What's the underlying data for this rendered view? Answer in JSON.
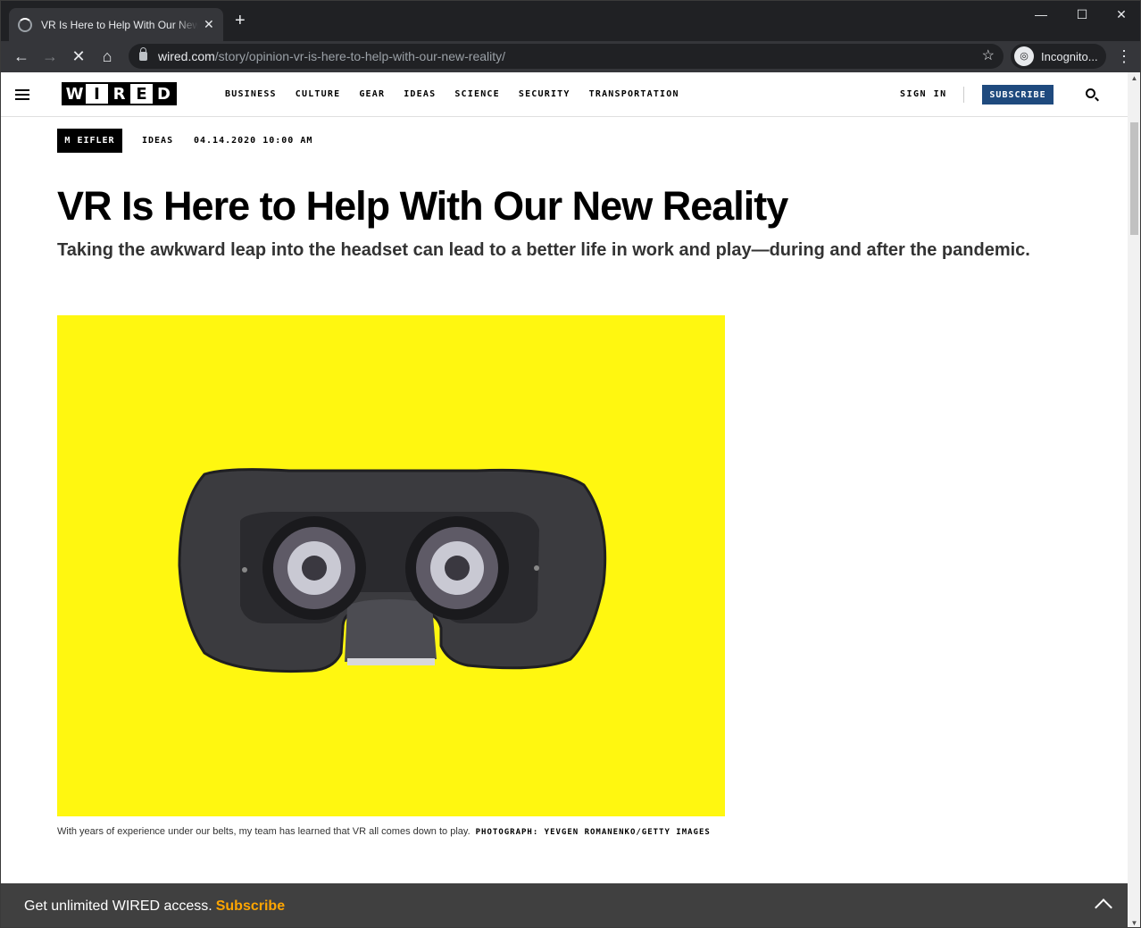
{
  "browser": {
    "tab_title": "VR Is Here to Help With Our New Reality",
    "url_host": "wired.com",
    "url_path": "/story/opinion-vr-is-here-to-help-with-our-new-reality/",
    "incognito_label": "Incognito..."
  },
  "nav": {
    "logo_letters": [
      "W",
      "I",
      "R",
      "E",
      "D"
    ],
    "links": [
      "BUSINESS",
      "CULTURE",
      "GEAR",
      "IDEAS",
      "SCIENCE",
      "SECURITY",
      "TRANSPORTATION"
    ],
    "sign_in": "SIGN IN",
    "subscribe": "SUBSCRIBE"
  },
  "article": {
    "author": "M EIFLER",
    "section": "IDEAS",
    "date": "04.14.2020 10:00 AM",
    "headline": "VR Is Here to Help With Our New Reality",
    "dek": "Taking the awkward leap into the headset can lead to a better life in work and play—during and after the pandemic.",
    "hero_bg": "#fff710",
    "caption": "With years of experience under our belts, my team has learned that VR all comes down to play.",
    "credit": "PHOTOGRAPH: YEVGEN ROMANENKO/GETTY IMAGES"
  },
  "paywall": {
    "text": "Get unlimited WIRED access.",
    "link": "Subscribe"
  }
}
